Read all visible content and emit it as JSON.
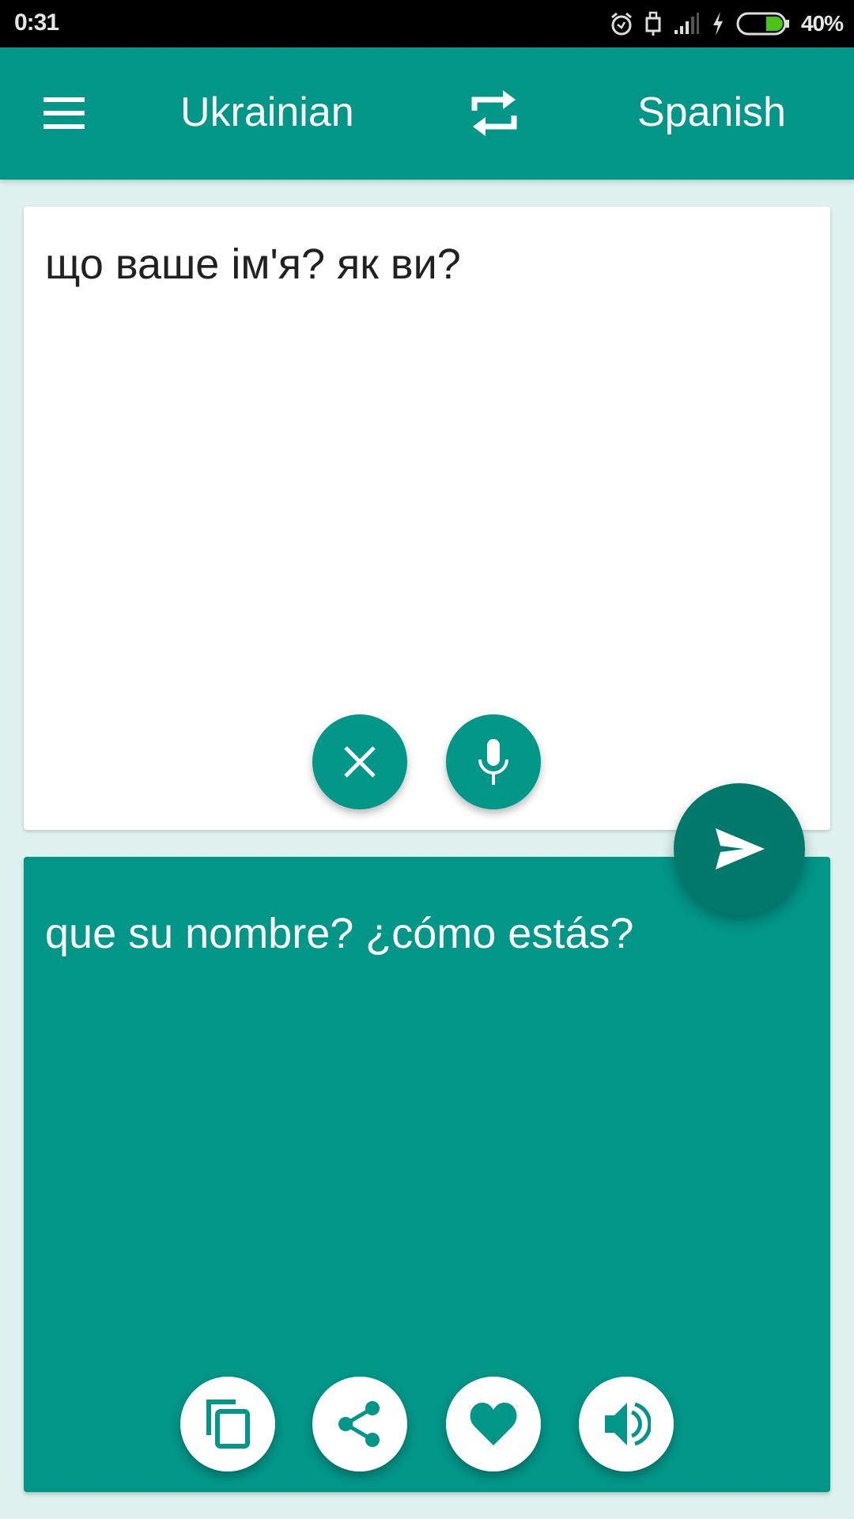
{
  "status_bar": {
    "time": "0:31",
    "icons": [
      "alarm-icon",
      "usb-icon",
      "signal-icon",
      "charging-icon",
      "battery-icon"
    ],
    "battery_percent": "40%",
    "battery_level": 0.4,
    "battery_color": "#4cc417"
  },
  "header": {
    "menu_icon": "hamburger-menu-icon",
    "source_language": "Ukrainian",
    "swap_icon": "swap-languages-icon",
    "target_language": "Spanish",
    "color": "#009688"
  },
  "input_card": {
    "text": "що ваше ім'я? як ви?",
    "buttons": [
      {
        "name": "clear",
        "icon": "close-icon"
      },
      {
        "name": "voice-input",
        "icon": "microphone-icon"
      }
    ]
  },
  "translate_button": {
    "icon": "send-icon",
    "color": "#00796b"
  },
  "output_card": {
    "text": "que su nombre? ¿cómo estás?",
    "buttons": [
      {
        "name": "copy",
        "icon": "copy-icon"
      },
      {
        "name": "share",
        "icon": "share-icon"
      },
      {
        "name": "favorite",
        "icon": "heart-icon"
      },
      {
        "name": "speak",
        "icon": "speaker-icon"
      }
    ]
  }
}
